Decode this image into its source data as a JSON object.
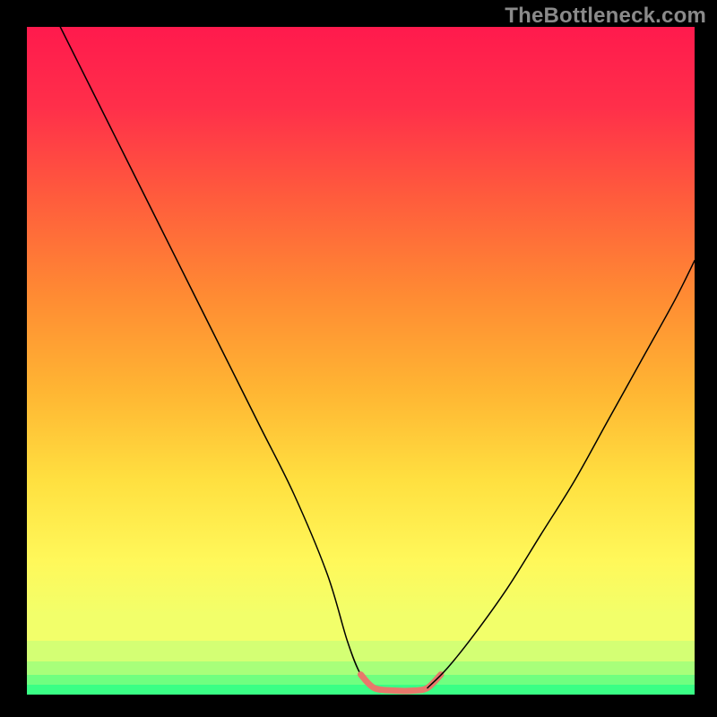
{
  "watermark": "TheBottleneck.com",
  "chart_data": {
    "type": "line",
    "title": "",
    "xlabel": "",
    "ylabel": "",
    "x_range": [
      0,
      100
    ],
    "y_range": [
      0,
      100
    ],
    "series": [
      {
        "name": "left-curve",
        "x": [
          5,
          10,
          15,
          20,
          25,
          30,
          35,
          40,
          45,
          48,
          50,
          52
        ],
        "y": [
          100,
          90,
          80,
          70,
          60,
          50,
          40,
          30,
          18,
          8,
          3,
          1
        ],
        "stroke": "#000000",
        "width": 1.5
      },
      {
        "name": "valley-highlight",
        "x": [
          50,
          52,
          55,
          58,
          60,
          62
        ],
        "y": [
          3,
          1,
          0.6,
          0.6,
          1,
          3
        ],
        "stroke": "#e8786b",
        "width": 7
      },
      {
        "name": "right-curve",
        "x": [
          60,
          63,
          67,
          72,
          77,
          82,
          87,
          92,
          97,
          100
        ],
        "y": [
          1,
          4,
          9,
          16,
          24,
          32,
          41,
          50,
          59,
          65
        ],
        "stroke": "#000000",
        "width": 1.5
      }
    ],
    "background_gradient": {
      "description": "vertical rainbow from red at top through orange, yellow, pale-green, to bright green at bottom",
      "stops": [
        {
          "pos": 0.0,
          "color": "#ff1a4d"
        },
        {
          "pos": 0.12,
          "color": "#ff2f4a"
        },
        {
          "pos": 0.25,
          "color": "#ff5a3d"
        },
        {
          "pos": 0.4,
          "color": "#ff8a33"
        },
        {
          "pos": 0.55,
          "color": "#ffb733"
        },
        {
          "pos": 0.68,
          "color": "#ffe040"
        },
        {
          "pos": 0.8,
          "color": "#fff85a"
        },
        {
          "pos": 0.88,
          "color": "#f2ff6a"
        },
        {
          "pos": 0.92,
          "color": "#d4ff74"
        },
        {
          "pos": 0.95,
          "color": "#a8ff7a"
        },
        {
          "pos": 0.97,
          "color": "#70ff80"
        },
        {
          "pos": 0.985,
          "color": "#3aff85"
        },
        {
          "pos": 1.0,
          "color": "#10e86f"
        }
      ]
    }
  }
}
